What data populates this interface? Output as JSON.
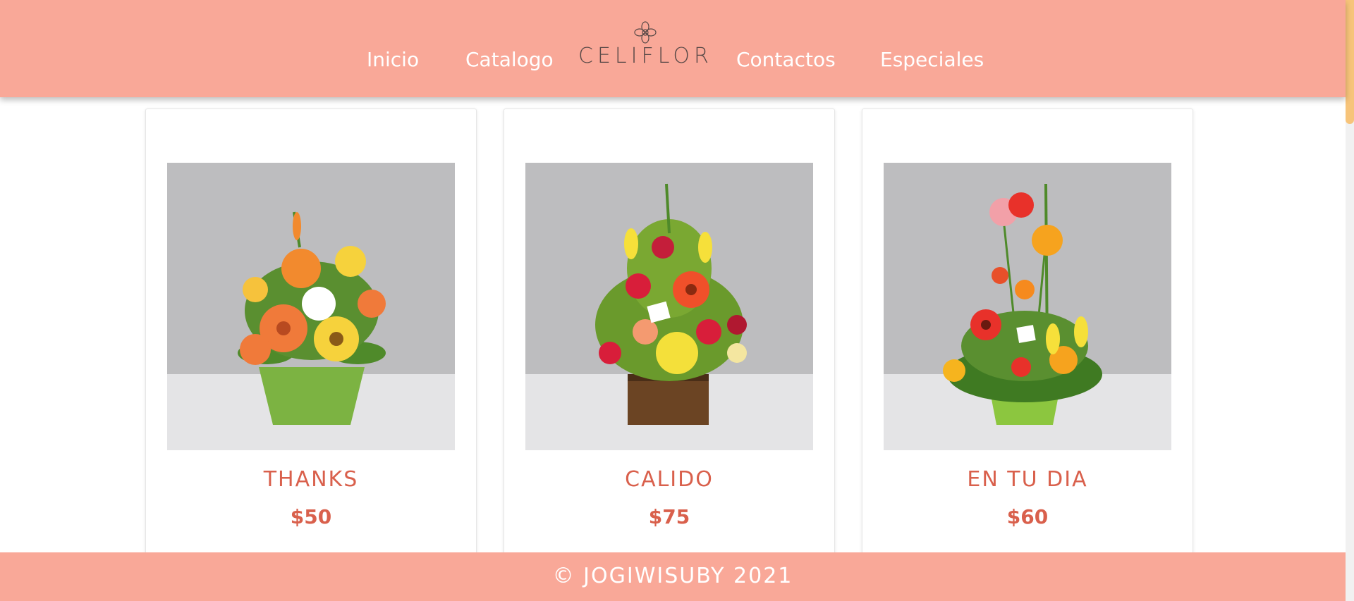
{
  "colors": {
    "header_bg": "#f9a898",
    "accent_text": "#d9604c",
    "logo_text": "#5a4a48",
    "scroll_thumb": "#f7c47a"
  },
  "nav": {
    "items": [
      {
        "label": "Inicio"
      },
      {
        "label": "Catalogo"
      },
      {
        "label": "Contactos"
      },
      {
        "label": "Especiales"
      }
    ],
    "logo": {
      "text": "CELIFLOR",
      "icon": "flower-icon"
    }
  },
  "products": [
    {
      "name": "THANKS",
      "price": "$50",
      "image": "orange-flower-arrangement-green-pot"
    },
    {
      "name": "CALIDO",
      "price": "$75",
      "image": "red-yellow-flower-arrangement-wooden-box"
    },
    {
      "name": "EN TU DIA",
      "price": "$60",
      "image": "tall-gerbera-arrangement-green-pot"
    }
  ],
  "footer": {
    "text": "© JOGIWISUBY 2021"
  }
}
